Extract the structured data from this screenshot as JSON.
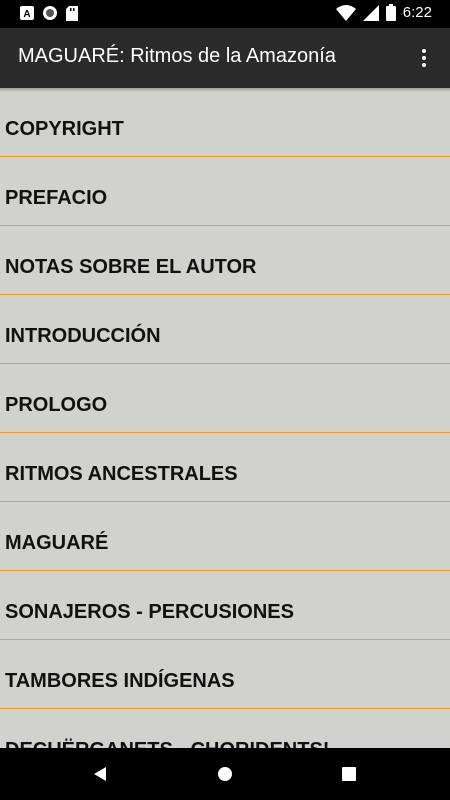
{
  "status_bar": {
    "time": "6:22",
    "left_icons": [
      "font-a-icon",
      "record-icon",
      "sd-card-icon"
    ],
    "right_icons": [
      "wifi-icon",
      "cell-signal-icon",
      "battery-icon"
    ]
  },
  "app_bar": {
    "title": "MAGUARÉ: Ritmos de la Amazonía",
    "overflow_icon": "more-vert-icon"
  },
  "list": {
    "items": [
      {
        "label": "COPYRIGHT"
      },
      {
        "label": "PREFACIO"
      },
      {
        "label": "NOTAS SOBRE EL AUTOR"
      },
      {
        "label": "INTRODUCCIÓN"
      },
      {
        "label": "PROLOGO"
      },
      {
        "label": "RITMOS ANCESTRALES"
      },
      {
        "label": "MAGUARÉ"
      },
      {
        "label": "SONAJEROS - PERCUSIONES"
      },
      {
        "label": "TAMBORES INDÍGENAS"
      },
      {
        "label": "DECUËRGANETS - CHORIDENTS!"
      }
    ]
  },
  "nav_bar": {
    "icons": [
      "back-icon",
      "home-icon",
      "recents-icon"
    ]
  },
  "colors": {
    "list_background": "#d1d1cd",
    "divider": "#f29c2b",
    "app_bar": "#2b2b2b",
    "status_bar": "#000000"
  }
}
